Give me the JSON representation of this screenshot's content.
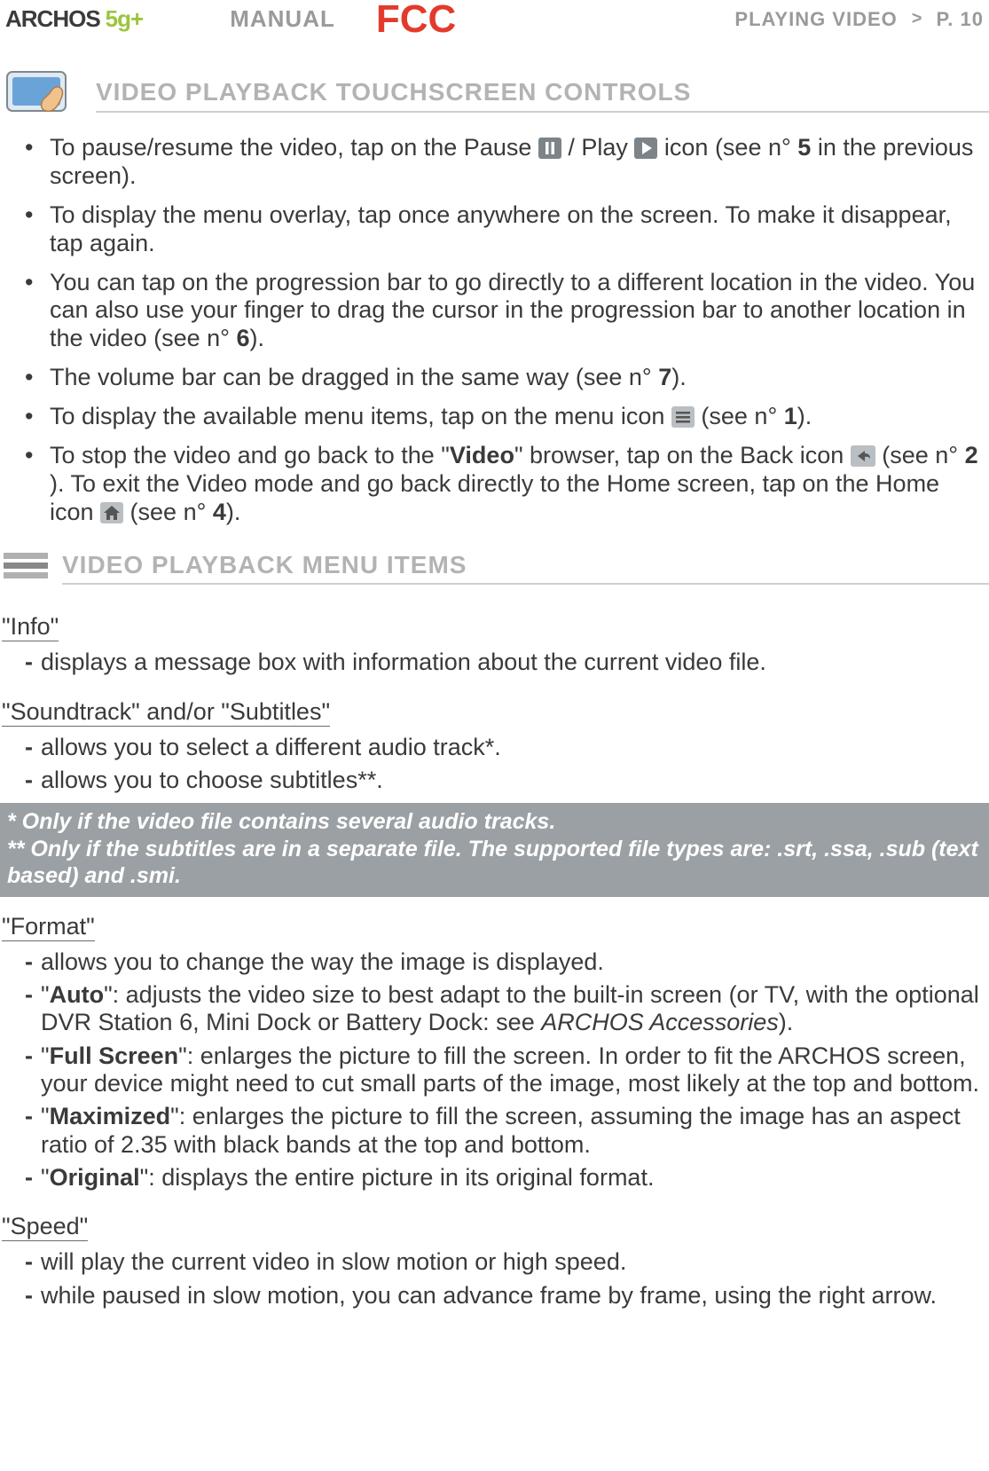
{
  "header": {
    "brand": "ARCHOS",
    "model": "5g+",
    "manual": "MANUAL",
    "fcc": "FCC",
    "section_title": "PLAYING VIDEO",
    "gt": ">",
    "page": "P. 10"
  },
  "section1": {
    "title": "VIDEO PLAYBACK TOUCHSCREEN CONTROLS",
    "bullets": {
      "b1_a": "To pause/resume the video, tap on the Pause ",
      "b1_b": " / Play ",
      "b1_c": " icon (see n° ",
      "b1_num": "5",
      "b1_d": " in the previous screen).",
      "b2": "To display the menu overlay, tap once anywhere on the screen. To make it disappear, tap again.",
      "b3_a": "You can tap on the progression bar to go directly to a different location in the video. You can also use your finger to drag the cursor in the progression bar to another location in the video (see n° ",
      "b3_num": "6",
      "b3_b": ").",
      "b4_a": "The volume bar can be dragged in the same way (see n° ",
      "b4_num": "7",
      "b4_b": ").",
      "b5_a": "To display the available menu items, tap on the menu icon ",
      "b5_b": " (see n° ",
      "b5_num": "1",
      "b5_c": ").",
      "b6_a": "To stop the video and go back to the \"",
      "b6_bold": "Video",
      "b6_b": "\" browser, tap on the Back icon ",
      "b6_c": " (see n° ",
      "b6_num1": "2",
      "b6_d": "). To exit the Video mode and go back directly to the Home screen, tap on the Home icon ",
      "b6_e": " (see n° ",
      "b6_num2": "4",
      "b6_f": ")."
    }
  },
  "section2": {
    "title": "VIDEO PLAYBACK MENU ITEMS",
    "info": {
      "hdr": "\"Info\"",
      "d1": "displays a message box with information about the current video file."
    },
    "soundtrack": {
      "hdr": "\"Soundtrack\" and/or \"Subtitles\"",
      "d1": "allows you to select a different audio track*.",
      "d2": "allows you to choose subtitles**."
    },
    "note": {
      "line1": "* Only if the video file contains several audio tracks.",
      "line2": "** Only if the subtitles are in a separate file. The supported file types are: .srt, .ssa, .sub (text based) and .smi."
    },
    "format": {
      "hdr": "\"Format\"",
      "d1": "allows you to change the way the image is displayed.",
      "d2_a": "\"",
      "d2_bold": "Auto",
      "d2_b": "\": adjusts the video size to best adapt to the built-in screen (or TV, with the optional DVR Station 6, Mini Dock or Battery Dock: see ",
      "d2_ref": "ARCHOS Accessories",
      "d2_c": ").",
      "d3_a": "\"",
      "d3_bold": "Full Screen",
      "d3_b": "\": enlarges the picture to fill the screen. In order to fit the ARCHOS screen, your device might need to cut small parts of the image, most likely at the top and bottom.",
      "d4_a": "\"",
      "d4_bold": "Maximized",
      "d4_b": "\": enlarges the picture to fill the screen, assuming the image has an aspect ratio of 2.35 with black bands at the top and bottom.",
      "d5_a": "\"",
      "d5_bold": "Original",
      "d5_b": "\": displays the entire picture in its original format."
    },
    "speed": {
      "hdr": "\"Speed\"",
      "d1": "will play the current video in slow motion or high speed.",
      "d2": "while paused in slow motion, you can advance frame by frame, using the right arrow."
    }
  }
}
